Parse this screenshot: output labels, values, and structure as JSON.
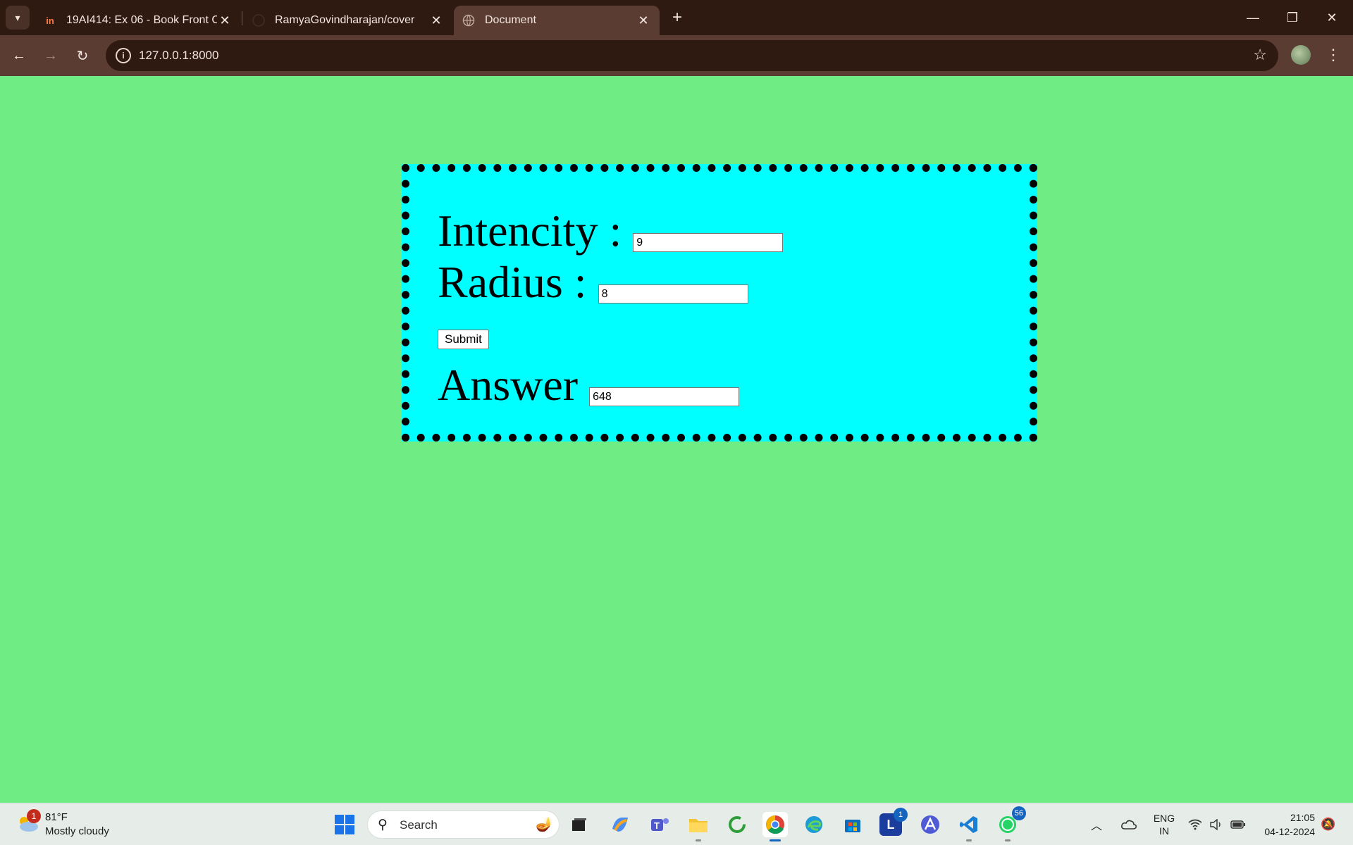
{
  "browser": {
    "tabs": [
      {
        "title": "19AI414: Ex 06 - Book Front Co",
        "favicon": "in-icon",
        "active": false
      },
      {
        "title": "RamyaGovindharajan/cover",
        "favicon": "github-icon",
        "active": false
      },
      {
        "title": "Document",
        "favicon": "globe-icon",
        "active": true
      }
    ],
    "url": "127.0.0.1:8000"
  },
  "form": {
    "intencity_label": "Intencity :",
    "intencity_value": "9",
    "radius_label": "Radius :",
    "radius_value": "8",
    "submit_label": "Submit",
    "answer_label": "Answer",
    "answer_value": "648"
  },
  "colors": {
    "page_background": "#6fec84",
    "card_background": "#00ffff",
    "card_border": "#000000"
  },
  "taskbar": {
    "weather": {
      "temp": "81°F",
      "desc": "Mostly cloudy",
      "badge": "1"
    },
    "search_placeholder": "Search",
    "apps": [
      {
        "name": "windows-start-icon"
      },
      {
        "name": "task-view-icon"
      },
      {
        "name": "copilot-icon"
      },
      {
        "name": "teams-icon"
      },
      {
        "name": "file-explorer-icon"
      },
      {
        "name": "circle-app-icon"
      },
      {
        "name": "chrome-icon"
      },
      {
        "name": "edge-icon"
      },
      {
        "name": "store-icon"
      },
      {
        "name": "l-app-icon",
        "badge": "1"
      },
      {
        "name": "a-app-icon"
      },
      {
        "name": "vscode-icon"
      },
      {
        "name": "whatsapp-icon",
        "badge": "56"
      }
    ],
    "language": {
      "line1": "ENG",
      "line2": "IN"
    },
    "time": "21:05",
    "date": "04-12-2024"
  }
}
